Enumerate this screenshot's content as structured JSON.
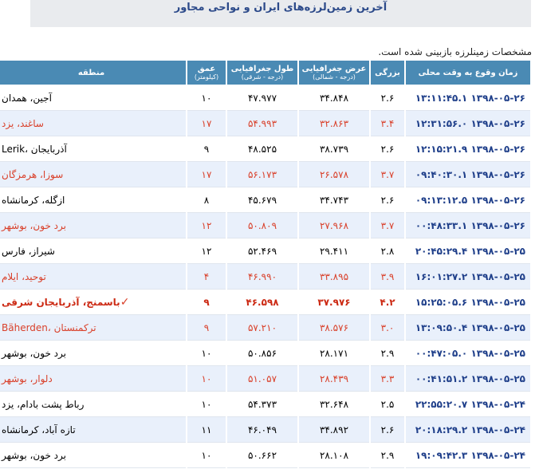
{
  "page": {
    "title": "آخرین زمین‌لرزه‌های ایران و نواحی مجاور",
    "note": "مشخصات زمینلرزه بازبینی شده است."
  },
  "table": {
    "headers": {
      "time": "زمان وقوع به وقت محلی",
      "magnitude": "بزرگی",
      "latitude": "عرض جغرافیایی",
      "latitude_unit": "(درجه - شمالی)",
      "longitude": "طول جغرافیایی",
      "longitude_unit": "(درجه - شرقی)",
      "depth": "عمق",
      "depth_unit": "(کیلومتر)",
      "region": "منطقه"
    },
    "rows": [
      {
        "time": "۱۳۹۸-۰۵-۲۶ ۱۳:۱۱:۴۵.۱",
        "mag": "۲.۶",
        "lat": "۳۴.۸۴۸",
        "lon": "۴۷.۹۷۷",
        "depth": "۱۰",
        "region": "آجین، همدان",
        "style": "normal",
        "felt": ""
      },
      {
        "time": "۱۳۹۸-۰۵-۲۶ ۱۲:۳۱:۵۶.۰",
        "mag": "۳.۴",
        "lat": "۳۲.۸۶۳",
        "lon": "۵۴.۹۹۳",
        "depth": "۱۷",
        "region": "ساغند، یزد",
        "style": "red",
        "felt": ""
      },
      {
        "time": "۱۳۹۸-۰۵-۲۶ ۱۲:۱۵:۲۱.۹",
        "mag": "۲.۶",
        "lat": "۳۸.۷۳۹",
        "lon": "۴۸.۵۲۵",
        "depth": "۹",
        "region": "Lerik، آذربایجان",
        "style": "normal",
        "felt": ""
      },
      {
        "time": "۱۳۹۸-۰۵-۲۶ ۰۹:۴۰:۳۰.۱",
        "mag": "۳.۷",
        "lat": "۲۶.۵۷۸",
        "lon": "۵۶.۱۷۳",
        "depth": "۱۷",
        "region": "سوزا، هرمزگان",
        "style": "red",
        "felt": ""
      },
      {
        "time": "۱۳۹۸-۰۵-۲۶ ۰۹:۱۳:۱۲.۵",
        "mag": "۲.۶",
        "lat": "۳۴.۷۴۳",
        "lon": "۴۵.۶۷۹",
        "depth": "۸",
        "region": "ازگله، کرمانشاه",
        "style": "normal",
        "felt": ""
      },
      {
        "time": "۱۳۹۸-۰۵-۲۶ ۰۰:۴۸:۳۳.۱",
        "mag": "۳.۷",
        "lat": "۲۷.۹۶۸",
        "lon": "۵۰.۸۰۹",
        "depth": "۱۲",
        "region": "برد خون، بوشهر",
        "style": "red",
        "felt": ""
      },
      {
        "time": "۱۳۹۸-۰۵-۲۵ ۲۰:۴۵:۲۹.۴",
        "mag": "۲.۸",
        "lat": "۲۹.۴۱۱",
        "lon": "۵۲.۴۶۹",
        "depth": "۱۲",
        "region": "شیراز، فارس",
        "style": "normal",
        "felt": ""
      },
      {
        "time": "۱۳۹۸-۰۵-۲۵ ۱۶:۰۱:۲۷.۲",
        "mag": "۳.۹",
        "lat": "۳۳.۸۹۵",
        "lon": "۴۶.۹۹۰",
        "depth": "۴",
        "region": "توحید، ایلام",
        "style": "red",
        "felt": ""
      },
      {
        "time": "۱۳۹۸-۰۵-۲۵ ۱۵:۲۵:۰۵.۶",
        "mag": "۴.۲",
        "lat": "۳۷.۹۷۶",
        "lon": "۴۶.۵۹۸",
        "depth": "۹",
        "region": "باسمنج، آذربایجان شرقی",
        "style": "strong",
        "felt": "✓"
      },
      {
        "time": "۱۳۹۸-۰۵-۲۵ ۱۳:۰۹:۵۰.۴",
        "mag": "۳.۰",
        "lat": "۳۸.۵۷۶",
        "lon": "۵۷.۲۱۰",
        "depth": "۹",
        "region": "Bäherden، ترکمنستان",
        "style": "red",
        "felt": ""
      },
      {
        "time": "۱۳۹۸-۰۵-۲۵ ۰۰:۴۷:۰۵.۰",
        "mag": "۲.۹",
        "lat": "۲۸.۱۷۱",
        "lon": "۵۰.۸۵۶",
        "depth": "۱۰",
        "region": "برد خون، بوشهر",
        "style": "normal",
        "felt": ""
      },
      {
        "time": "۱۳۹۸-۰۵-۲۵ ۰۰:۴۱:۵۱.۲",
        "mag": "۳.۳",
        "lat": "۲۸.۴۳۹",
        "lon": "۵۱.۰۵۷",
        "depth": "۱۰",
        "region": "دلوار، بوشهر",
        "style": "red",
        "felt": ""
      },
      {
        "time": "۱۳۹۸-۰۵-۲۴ ۲۲:۵۵:۲۰.۷",
        "mag": "۲.۵",
        "lat": "۳۲.۶۴۸",
        "lon": "۵۴.۳۷۳",
        "depth": "۱۰",
        "region": "رباط پشت بادام، یزد",
        "style": "normal",
        "felt": ""
      },
      {
        "time": "۱۳۹۸-۰۵-۲۴ ۲۰:۱۸:۲۹.۲",
        "mag": "۲.۶",
        "lat": "۳۴.۸۹۲",
        "lon": "۴۶.۰۴۹",
        "depth": "۱۱",
        "region": "تازه آباد، کرمانشاه",
        "style": "normal",
        "felt": ""
      },
      {
        "time": "۱۳۹۸-۰۵-۲۴ ۱۹:۰۹:۴۲.۳",
        "mag": "۲.۹",
        "lat": "۲۸.۱۰۸",
        "lon": "۵۰.۶۶۲",
        "depth": "۱۰",
        "region": "برد خون، بوشهر",
        "style": "normal",
        "felt": ""
      }
    ]
  },
  "colors": {
    "header_bg": "#4a8ab4",
    "title_bg": "#e9ebee",
    "title_text": "#2c4a8a",
    "alt_row_bg": "#e9f0fb",
    "red_text": "#d9402a",
    "time_text": "#1f3f8a"
  },
  "icons": {
    "felt": "check-mark-icon"
  }
}
